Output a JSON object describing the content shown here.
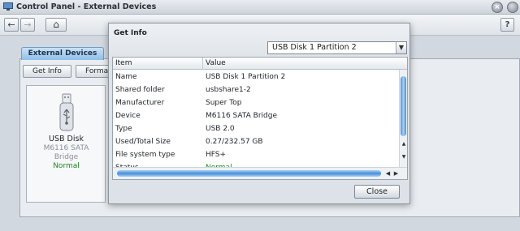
{
  "window": {
    "title": "Control Panel - External Devices",
    "close_glyph": "×",
    "help_label": "?"
  },
  "nav": {
    "back_icon": "arrow-left-icon",
    "forward_icon": "arrow-right-icon",
    "home_icon": "home-icon",
    "back_glyph": "←",
    "forward_glyph": "→",
    "home_glyph": "⌂"
  },
  "main": {
    "tab_label": "External Devices",
    "toolbar": {
      "get_info_label": "Get Info",
      "format_label": "Format"
    },
    "device": {
      "name": "USB Disk",
      "model_line1": "M6116 SATA",
      "model_line2": "Bridge",
      "status": "Normal",
      "icon": "usb-drive-icon"
    }
  },
  "dialog": {
    "title": "Get Info",
    "partition_selected": "USB Disk 1 Partition 2",
    "columns": {
      "item": "Item",
      "value": "Value"
    },
    "rows": [
      {
        "item": "Name",
        "value": "USB Disk 1 Partition 2"
      },
      {
        "item": "Shared folder",
        "value": "usbshare1-2"
      },
      {
        "item": "Manufacturer",
        "value": "Super Top"
      },
      {
        "item": "Device",
        "value": "M6116 SATA Bridge"
      },
      {
        "item": "Type",
        "value": "USB 2.0"
      },
      {
        "item": "Used/Total Size",
        "value": "0.27/232.57 GB"
      },
      {
        "item": "File system type",
        "value": "HFS+"
      },
      {
        "item": "Status",
        "value": "Normal"
      }
    ],
    "close_label": "Close"
  },
  "colors": {
    "status_ok": "#1a8a1a",
    "tab_active": "#8fbfe9",
    "scroll_thumb": "#4a8fd8"
  }
}
